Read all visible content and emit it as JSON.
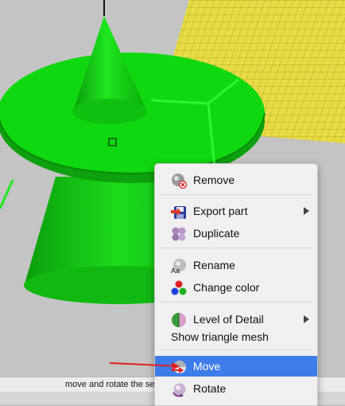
{
  "status": {
    "text": "move and rotate the se                                                                 keys"
  },
  "menu": {
    "items": [
      {
        "label": "Remove",
        "icon": "remove-icon"
      },
      {
        "label": "Export part",
        "icon": "export-part-icon",
        "submenu": true
      },
      {
        "label": "Duplicate",
        "icon": "duplicate-icon"
      },
      {
        "label": "Rename",
        "icon": "rename-icon"
      },
      {
        "label": "Change color",
        "icon": "change-color-icon"
      },
      {
        "label": "Level of Detail",
        "icon": "level-of-detail-icon",
        "submenu": true
      },
      {
        "label": "Show triangle mesh"
      },
      {
        "label": "Move",
        "icon": "move-icon",
        "selected": true
      },
      {
        "label": "Rotate",
        "icon": "rotate-icon"
      }
    ]
  },
  "colors": {
    "model_green": "#0fd20f",
    "platform_yellow": "#e8dc45",
    "highlight_blue": "#3d7dea",
    "annotation_red": "#e02020"
  }
}
